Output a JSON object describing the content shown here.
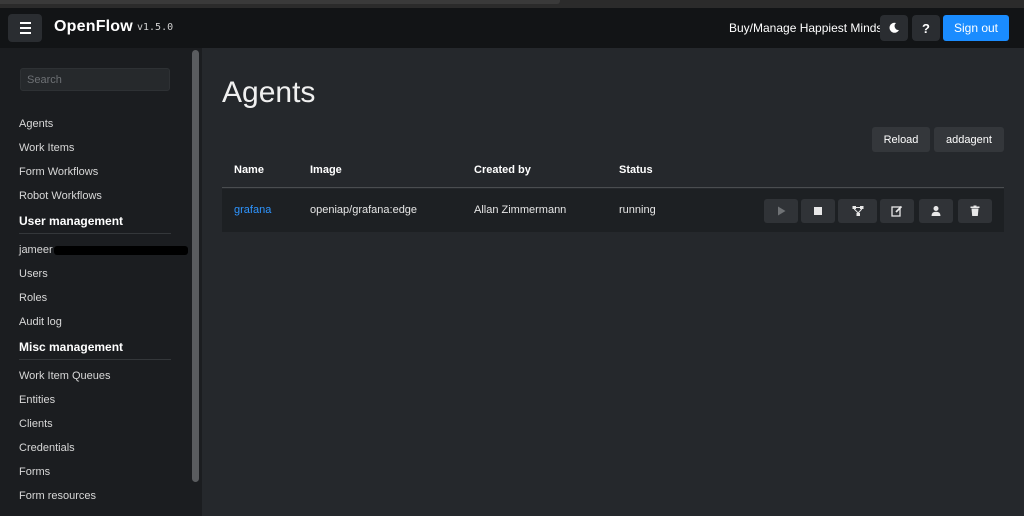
{
  "app": {
    "name": "OpenFlow",
    "version": "v1.5.0"
  },
  "header": {
    "buy_link": "Buy/Manage Happiest Minds",
    "theme_icon": "moon-icon",
    "help_label": "?",
    "signout_label": "Sign out"
  },
  "sidebar": {
    "search_placeholder": "Search",
    "items1": [
      "Agents",
      "Work Items",
      "Form Workflows",
      "Robot Workflows"
    ],
    "section_user": "User management",
    "user_email_visible": "jameer",
    "items2": [
      "Users",
      "Roles",
      "Audit log"
    ],
    "section_misc": "Misc management",
    "items3": [
      "Work Item Queues",
      "Entities",
      "Clients",
      "Credentials",
      "Forms",
      "Form resources"
    ]
  },
  "main": {
    "title": "Agents",
    "reload_label": "Reload",
    "add_label": "addagent",
    "columns": [
      "Name",
      "Image",
      "Created by",
      "Status"
    ],
    "rows": [
      {
        "name": "grafana",
        "image": "openiap/grafana:edge",
        "created_by": "Allan Zimmermann",
        "status": "running"
      }
    ],
    "row_actions": [
      "play-icon",
      "stop-icon",
      "sitemap-icon",
      "edit-icon",
      "user-icon",
      "trash-icon"
    ]
  },
  "colors": {
    "accent": "#1a8cff",
    "link": "#2e95ff",
    "background": "#25282c",
    "sidebar": "#1b1d20",
    "topbar": "#121416"
  }
}
